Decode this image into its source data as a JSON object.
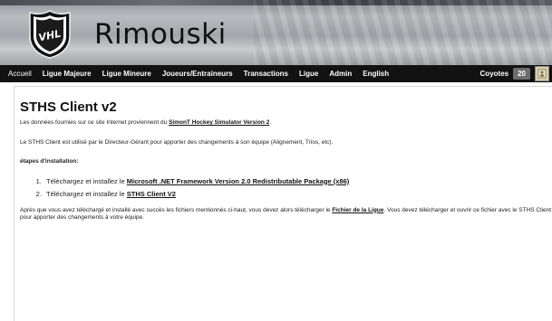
{
  "header": {
    "site_title": "Rimouski",
    "logo_text": "VHL"
  },
  "nav": {
    "items": [
      "Accueil",
      "Ligue Majeure",
      "Ligue Mineure",
      "Joueurs/Entraineurs",
      "Transactions",
      "Ligue",
      "Admin",
      "English"
    ],
    "team_name": "Coyotes",
    "team_badge": "20",
    "help_icon": "help-icon"
  },
  "main": {
    "title": "STHS Client v2",
    "p1_before": "Les données fournies sur ce site Internet proviennent du ",
    "p1_link": "SimonT Hockey Simulator Version 2",
    "p1_after": ".",
    "p2": "Le STHS Client est utilisé par le Directeur-Gérant pour apporter des changements à son équipe (Alignement, Trios, etc).",
    "p3": "étapes d'installation:",
    "step1_before": "Téléchargez et installez le ",
    "step1_link": "Microsoft .NET Framework Version 2.0 Redistributable Package (x86)",
    "step2_before": "Téléchargez et installez le ",
    "step2_link": "STHS Client V2",
    "p4_before": "Après que vous avez téléchargé et installé avec succès les fichiers mentionnés ci-haut, vous devez alors télécharger le ",
    "p4_link": "Fichier de la Ligue",
    "p4_after": ". Vous devez télécharger et ouvrir ce fichier avec le STHS Client pour apporter des changements à votre équipe."
  }
}
